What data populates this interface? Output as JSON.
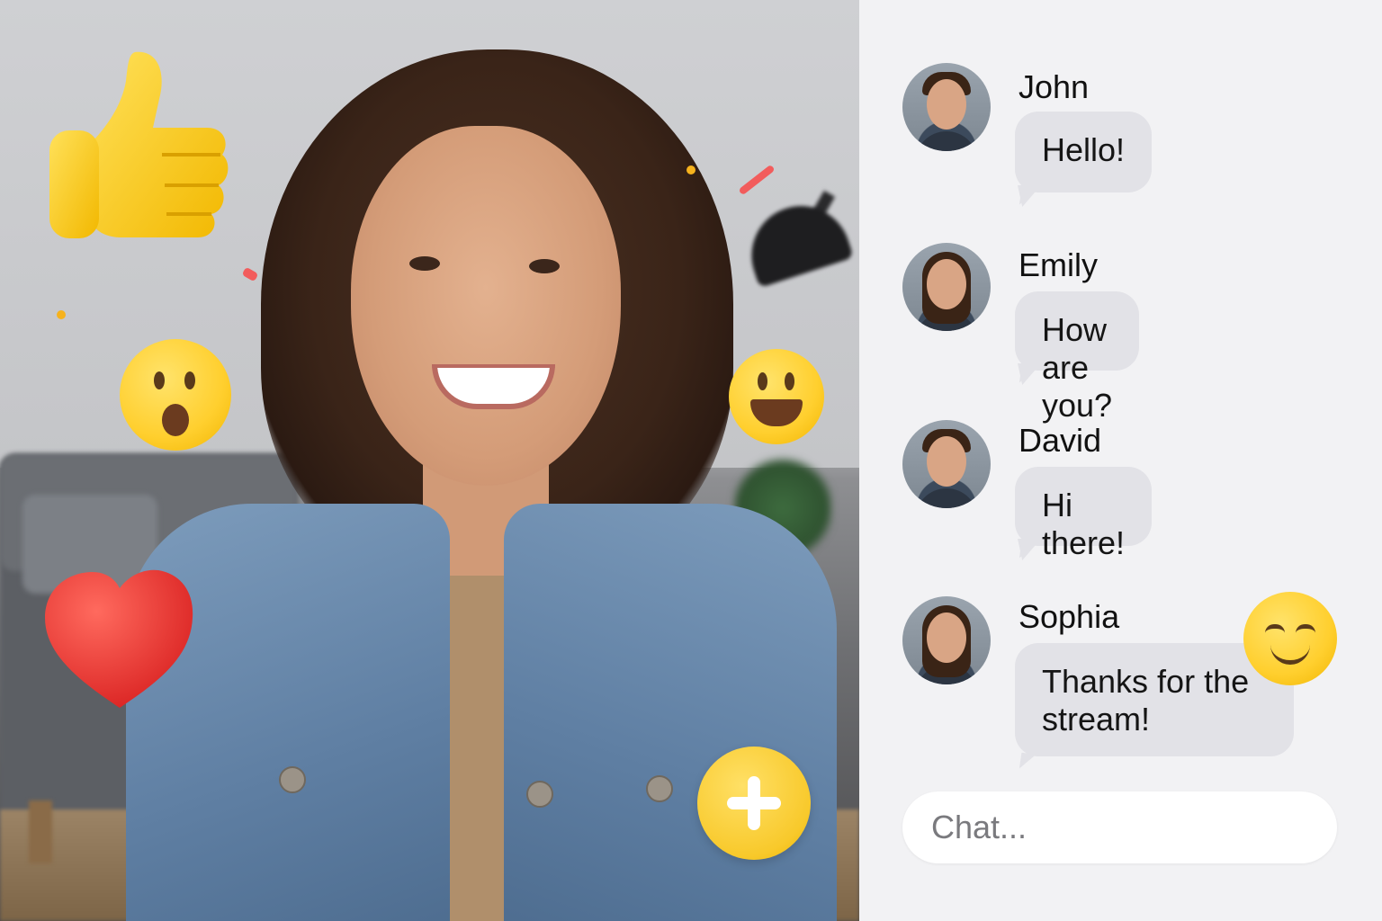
{
  "chat": {
    "messages": [
      {
        "sender": "John",
        "text": "Hello!"
      },
      {
        "sender": "Emily",
        "text": "How are you?"
      },
      {
        "sender": "David",
        "text": "Hi there!"
      },
      {
        "sender": "Sophia",
        "text": "Thanks for the stream!"
      }
    ],
    "input_placeholder": "Chat..."
  },
  "reactions": [
    "thumbs-up-icon",
    "surprised-face-icon",
    "grinning-face-icon",
    "heart-icon",
    "smiling-face-icon"
  ],
  "colors": {
    "chat_bubble": "#e2e2e7",
    "add_reaction": "#f8c92b",
    "panel_bg": "#f2f2f4"
  }
}
